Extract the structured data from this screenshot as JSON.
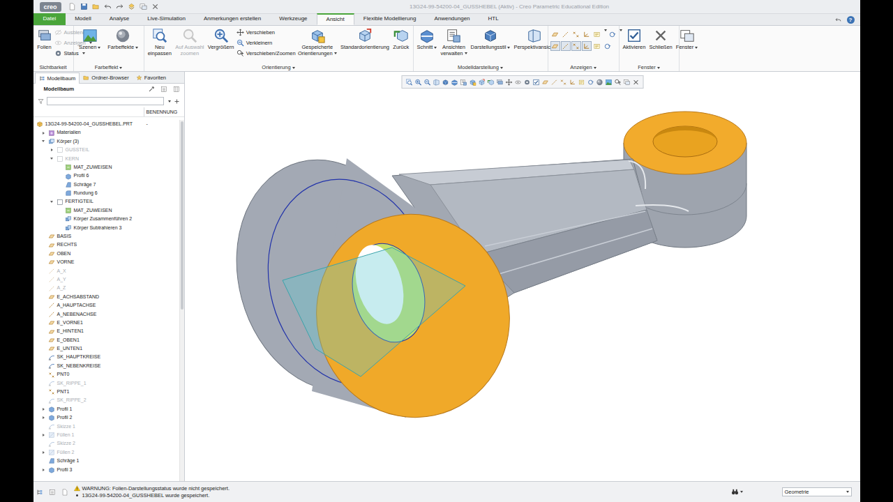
{
  "window": {
    "title": "13G24-99-54200-04_GUSSHEBEL (Aktiv) - Creo Parametric Educational Edition",
    "logo": "creo"
  },
  "help": "?",
  "ribbon_tabs": [
    {
      "label": "Datei",
      "kind": "file",
      "selected": false
    },
    {
      "label": "Modell",
      "kind": "tab",
      "selected": false
    },
    {
      "label": "Analyse",
      "kind": "tab",
      "selected": false
    },
    {
      "label": "Live-Simulation",
      "kind": "tab",
      "selected": false
    },
    {
      "label": "Anmerkungen erstellen",
      "kind": "tab",
      "selected": false
    },
    {
      "label": "Werkzeuge",
      "kind": "tab",
      "selected": false
    },
    {
      "label": "Ansicht",
      "kind": "tab",
      "selected": true
    },
    {
      "label": "Flexible Modellierung",
      "kind": "tab",
      "selected": false
    },
    {
      "label": "Anwendungen",
      "kind": "tab",
      "selected": false
    },
    {
      "label": "HTL",
      "kind": "tab",
      "selected": false
    }
  ],
  "ribbon_groups": [
    {
      "label": "Sichtbarkeit",
      "dropdown": false,
      "items": [
        {
          "kind": "large",
          "lines": [
            "Folien"
          ],
          "disabled": false,
          "dropdown": false
        },
        {
          "kind": "stack",
          "items": [
            {
              "label": "Ausblenden",
              "disabled": true,
              "dropdown": false
            },
            {
              "label": "Anzeigen",
              "disabled": true,
              "dropdown": true
            },
            {
              "label": "Status",
              "disabled": false,
              "dropdown": true
            }
          ]
        }
      ]
    },
    {
      "label": "Farbeffekt",
      "dropdown": true,
      "items": [
        {
          "kind": "large",
          "lines": [
            "Szenen"
          ],
          "disabled": false,
          "dropdown": true
        },
        {
          "kind": "large",
          "lines": [
            "Farbeffekte"
          ],
          "disabled": false,
          "dropdown": true
        }
      ]
    },
    {
      "label": "Orientierung",
      "dropdown": true,
      "items": [
        {
          "kind": "large",
          "lines": [
            "Neu",
            "einpassen"
          ],
          "disabled": false,
          "dropdown": false
        },
        {
          "kind": "large",
          "lines": [
            "Auf Auswahl",
            "zoomen"
          ],
          "disabled": true,
          "dropdown": false
        },
        {
          "kind": "large",
          "lines": [
            "Vergrößern"
          ],
          "disabled": false,
          "dropdown": false
        },
        {
          "kind": "stack",
          "items": [
            {
              "label": "Verschieben",
              "disabled": false,
              "dropdown": false
            },
            {
              "label": "Verkleinern",
              "disabled": false,
              "dropdown": false
            },
            {
              "label": "Verschieben/Zoomen",
              "disabled": false,
              "dropdown": false
            }
          ]
        },
        {
          "kind": "large",
          "lines": [
            "Gespeicherte",
            "Orientierungen"
          ],
          "disabled": false,
          "dropdown": true
        },
        {
          "kind": "large",
          "lines": [
            "Standardorientierung"
          ],
          "disabled": false,
          "dropdown": false
        },
        {
          "kind": "large",
          "lines": [
            "Zurück"
          ],
          "disabled": false,
          "dropdown": false
        }
      ]
    },
    {
      "label": "Modelldarstellung",
      "dropdown": true,
      "items": [
        {
          "kind": "large",
          "lines": [
            "Schnitt"
          ],
          "disabled": false,
          "dropdown": true
        },
        {
          "kind": "large",
          "lines": [
            "Ansichten",
            "verwalten"
          ],
          "disabled": false,
          "dropdown": true
        },
        {
          "kind": "large",
          "lines": [
            "Darstellungsstil"
          ],
          "disabled": false,
          "dropdown": true
        },
        {
          "kind": "large",
          "lines": [
            "Perspektivansicht"
          ],
          "disabled": false,
          "dropdown": false
        }
      ]
    },
    {
      "label": "Anzeigen",
      "dropdown": true,
      "items": [
        {
          "kind": "toggles",
          "rows": [
            [
              {
                "selected": false,
                "dropdown": false
              },
              {
                "selected": false,
                "dropdown": false
              },
              {
                "selected": false,
                "dropdown": false
              },
              {
                "selected": false,
                "dropdown": false
              },
              {
                "selected": false,
                "dropdown": true
              },
              {
                "selected": false,
                "dropdown": true
              }
            ],
            [
              {
                "selected": true,
                "dropdown": false
              },
              {
                "selected": true,
                "dropdown": false
              },
              {
                "selected": true,
                "dropdown": false
              },
              {
                "selected": true,
                "dropdown": false
              },
              {
                "selected": false,
                "dropdown": false
              },
              {
                "selected": false,
                "dropdown": false
              }
            ]
          ]
        }
      ]
    },
    {
      "label": "Fenster",
      "dropdown": true,
      "items": [
        {
          "kind": "large",
          "lines": [
            "Aktivieren"
          ],
          "disabled": false,
          "dropdown": false
        },
        {
          "kind": "large",
          "lines": [
            "Schließen"
          ],
          "disabled": false,
          "dropdown": false
        },
        {
          "kind": "large",
          "lines": [
            "Fenster"
          ],
          "disabled": false,
          "dropdown": true
        }
      ]
    }
  ],
  "model_tree": {
    "tabs": [
      {
        "label": "Modellbaum",
        "selected": true
      },
      {
        "label": "Ordner-Browser",
        "selected": false
      },
      {
        "label": "Favoriten",
        "selected": false
      }
    ],
    "title": "Modellbaum",
    "column": "BENENNUNG",
    "items": [
      {
        "label": "13G24-99-54200-04_GUSSHEBEL.PRT",
        "depth": 0,
        "kind": "part",
        "expandable": false,
        "disabled": false,
        "value": "-"
      },
      {
        "label": "Materialien",
        "depth": 1,
        "kind": "materials",
        "expandable": true,
        "expanded": false,
        "disabled": false
      },
      {
        "label": "Körper (3)",
        "depth": 1,
        "kind": "bodies",
        "expandable": true,
        "expanded": true,
        "disabled": false
      },
      {
        "label": "GUSSTEIL",
        "depth": 2,
        "kind": "body",
        "expandable": true,
        "expanded": false,
        "disabled": true
      },
      {
        "label": "KERN",
        "depth": 2,
        "kind": "body",
        "expandable": true,
        "expanded": true,
        "disabled": true
      },
      {
        "label": "MAT_ZUWEISEN",
        "depth": 3,
        "kind": "feature",
        "expandable": false,
        "disabled": false
      },
      {
        "label": "Profil 6",
        "depth": 3,
        "kind": "profile",
        "expandable": false,
        "disabled": false
      },
      {
        "label": "Schräge 7",
        "depth": 3,
        "kind": "draft",
        "expandable": false,
        "disabled": false
      },
      {
        "label": "Rundung 6",
        "depth": 3,
        "kind": "round",
        "expandable": false,
        "disabled": false
      },
      {
        "label": "FERTIGTEIL",
        "depth": 2,
        "kind": "body",
        "expandable": true,
        "expanded": true,
        "disabled": false
      },
      {
        "label": "MAT_ZUWEISEN",
        "depth": 3,
        "kind": "feature",
        "expandable": false,
        "disabled": false
      },
      {
        "label": "Körper Zusammenführen 2",
        "depth": 3,
        "kind": "merge",
        "expandable": false,
        "disabled": false
      },
      {
        "label": "Körper Subtrahieren 3",
        "depth": 3,
        "kind": "merge",
        "expandable": false,
        "disabled": false
      },
      {
        "label": "BASIS",
        "depth": 1,
        "kind": "plane",
        "expandable": false,
        "disabled": false
      },
      {
        "label": "RECHTS",
        "depth": 1,
        "kind": "plane",
        "expandable": false,
        "disabled": false
      },
      {
        "label": "OBEN",
        "depth": 1,
        "kind": "plane",
        "expandable": false,
        "disabled": false
      },
      {
        "label": "VORNE",
        "depth": 1,
        "kind": "plane",
        "expandable": false,
        "disabled": false
      },
      {
        "label": "A_X",
        "depth": 1,
        "kind": "axis",
        "expandable": false,
        "disabled": true
      },
      {
        "label": "A_Y",
        "depth": 1,
        "kind": "axis",
        "expandable": false,
        "disabled": true
      },
      {
        "label": "A_Z",
        "depth": 1,
        "kind": "axis",
        "expandable": false,
        "disabled": true
      },
      {
        "label": "E_ACHSABSTAND",
        "depth": 1,
        "kind": "plane",
        "expandable": false,
        "disabled": false
      },
      {
        "label": "A_HAUPTACHSE",
        "depth": 1,
        "kind": "axis",
        "expandable": false,
        "disabled": false
      },
      {
        "label": "A_NEBENACHSE",
        "depth": 1,
        "kind": "axis",
        "expandable": false,
        "disabled": false
      },
      {
        "label": "E_VORNE1",
        "depth": 1,
        "kind": "plane",
        "expandable": false,
        "disabled": false
      },
      {
        "label": "E_HINTEN1",
        "depth": 1,
        "kind": "plane",
        "expandable": false,
        "disabled": false
      },
      {
        "label": "E_OBEN1",
        "depth": 1,
        "kind": "plane",
        "expandable": false,
        "disabled": false
      },
      {
        "label": "E_UNTEN1",
        "depth": 1,
        "kind": "plane",
        "expandable": false,
        "disabled": false
      },
      {
        "label": "SK_HAUPTKREISE",
        "depth": 1,
        "kind": "sketch",
        "expandable": false,
        "disabled": false
      },
      {
        "label": "SK_NEBENKREISE",
        "depth": 1,
        "kind": "sketch",
        "expandable": false,
        "disabled": false
      },
      {
        "label": "PNT0",
        "depth": 1,
        "kind": "point",
        "expandable": false,
        "disabled": false
      },
      {
        "label": "SK_RIPPE_1",
        "depth": 1,
        "kind": "sketch",
        "expandable": false,
        "disabled": true
      },
      {
        "label": "PNT1",
        "depth": 1,
        "kind": "point",
        "expandable": false,
        "disabled": false
      },
      {
        "label": "SK_RIPPE_2",
        "depth": 1,
        "kind": "sketch",
        "expandable": false,
        "disabled": true
      },
      {
        "label": "Profil 1",
        "depth": 1,
        "kind": "profile",
        "expandable": true,
        "expanded": false,
        "disabled": false
      },
      {
        "label": "Profil 2",
        "depth": 1,
        "kind": "profile",
        "expandable": true,
        "expanded": false,
        "disabled": false
      },
      {
        "label": "Skizze 1",
        "depth": 1,
        "kind": "sketch",
        "expandable": false,
        "disabled": true
      },
      {
        "label": "Füllen 1",
        "depth": 1,
        "kind": "fill",
        "expandable": true,
        "expanded": false,
        "disabled": true
      },
      {
        "label": "Skizze 2",
        "depth": 1,
        "kind": "sketch",
        "expandable": false,
        "disabled": true
      },
      {
        "label": "Füllen 2",
        "depth": 1,
        "kind": "fill",
        "expandable": true,
        "expanded": false,
        "disabled": true
      },
      {
        "label": "Schräge 1",
        "depth": 1,
        "kind": "draft",
        "expandable": false,
        "disabled": false
      },
      {
        "label": "Profil 3",
        "depth": 1,
        "kind": "profile",
        "expandable": true,
        "expanded": false,
        "disabled": false
      }
    ]
  },
  "status_bar": {
    "messages": [
      {
        "text": "WARNUNG: Folien-Darstellungsstatus wurde nicht gespeichert.",
        "kind": "warning"
      },
      {
        "text": "13G24-99-54200-04_GUSSHEBEL wurde gespeichert.",
        "kind": "info"
      }
    ],
    "filter": "Geometrie"
  }
}
